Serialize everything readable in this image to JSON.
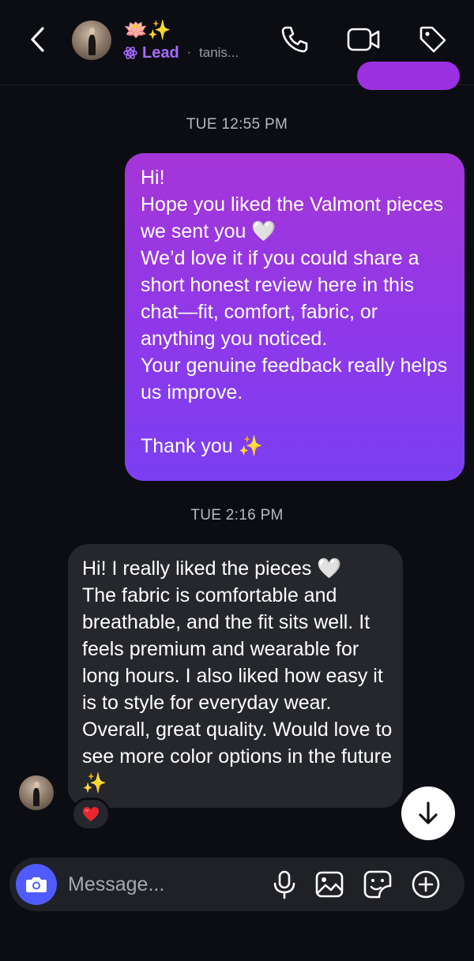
{
  "header": {
    "name_emojis": "🪷✨",
    "label": "Lead",
    "separator": "·",
    "handle": "tanis...",
    "accent_color": "#a56bff",
    "icons": [
      "back-chevron-icon",
      "phone-icon",
      "video-icon",
      "tag-icon"
    ]
  },
  "thread": [
    {
      "timestamp": "TUE 12:55 PM",
      "direction": "outgoing",
      "text": "Hi!\nHope you liked the Valmont pieces we sent you 🤍\nWe’d love it if you could share a short honest review here in this chat—fit, comfort, fabric, or anything you noticed.\nYour genuine feedback really helps us improve.\n\nThank you ✨"
    },
    {
      "timestamp": "TUE 2:16 PM",
      "direction": "incoming",
      "text": "Hi! I really liked the pieces 🤍\nThe fabric is comfortable and breathable, and the fit sits well. It feels premium and wearable for long hours. I also liked how easy it is to style for everyday wear. Overall, great quality. Would love to see more color options in the future ✨",
      "reaction": "❤️"
    }
  ],
  "composer": {
    "placeholder": "Message...",
    "value": "",
    "icons": [
      "camera-icon",
      "microphone-icon",
      "gallery-icon",
      "sticker-icon",
      "plus-icon"
    ],
    "camera_color": "#4f5bff"
  },
  "colors": {
    "background": "#0c0d12",
    "outgoing_top": "#a536d8",
    "outgoing_bottom": "#7b3ff2",
    "incoming": "#25272c"
  }
}
